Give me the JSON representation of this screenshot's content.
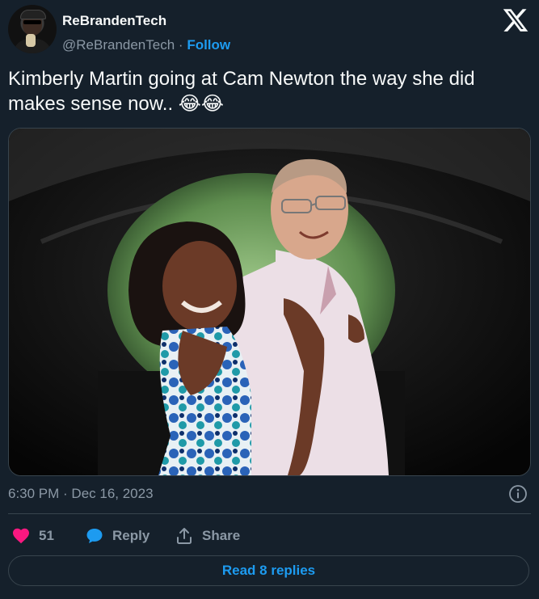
{
  "author": {
    "name": "ReBrandenTech",
    "handle": "@ReBrandenTech",
    "separator": "·",
    "follow_label": "Follow"
  },
  "tweet": {
    "text": "Kimberly Martin going at Cam Newton the way she did makes sense now.. 😂😂"
  },
  "media": {
    "icon": "photo"
  },
  "meta": {
    "timestamp": "6:30 PM · Dec 16, 2023"
  },
  "actions": {
    "likes_count": "51",
    "reply_label": "Reply",
    "share_label": "Share"
  },
  "footer": {
    "read_replies_label": "Read 8 replies"
  },
  "colors": {
    "background": "#15202b",
    "accent": "#1d9bf0",
    "like": "#f91880",
    "muted": "#8b98a5",
    "border": "#38444d"
  }
}
